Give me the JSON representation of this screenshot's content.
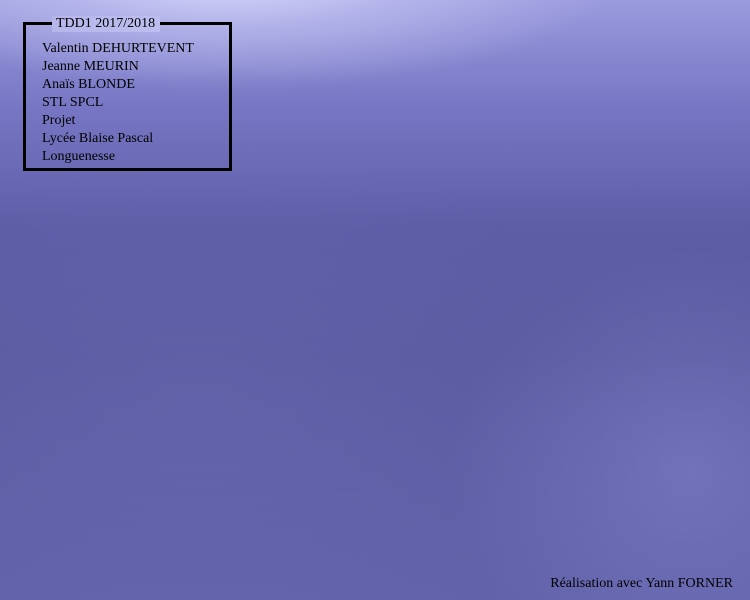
{
  "info_box": {
    "title": "TDD1 2017/2018",
    "lines": [
      "Valentin DEHURTEVENT",
      "Jeanne MEURIN",
      "Anaïs BLONDE",
      "STL SPCL",
      "Projet",
      "Lycée Blaise Pascal",
      "Longuenesse"
    ]
  },
  "footer": {
    "credit": "Réalisation avec Yann FORNER"
  },
  "colors": {
    "background_top": "#9a9ade",
    "background_main": "#5d5da6",
    "border": "#000000",
    "text": "#000000"
  }
}
